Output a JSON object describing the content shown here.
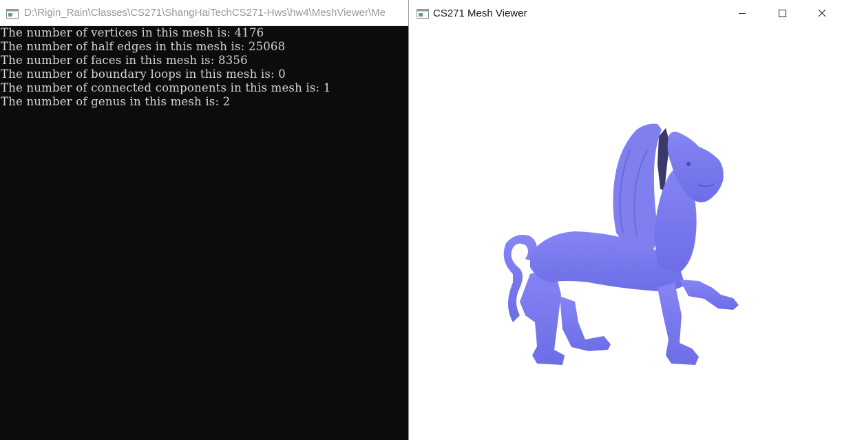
{
  "console_window": {
    "title": "D:\\Rigin_Rain\\Classes\\CS271\\ShangHaiTechCS271-Hws\\hw4\\MeshViewer\\Me",
    "icon": "console-app-icon",
    "lines": [
      "The number of vertices in this mesh is: 4176",
      "The number of half edges in this mesh is: 25068",
      "The number of faces in this mesh is: 8356",
      "The number of boundary loops in this mesh is: 0",
      "The number of connected components in this mesh is: 1",
      "The number of genus in this mesh is: 2"
    ]
  },
  "viewer_window": {
    "title": "CS271 Mesh Viewer",
    "icon": "window-app-icon",
    "controls": {
      "minimize_icon": "minimize-icon",
      "maximize_icon": "maximize-icon",
      "close_icon": "close-icon"
    },
    "model_icon": "winged-lion-mesh",
    "colors": {
      "mesh_fill": "#7f7ff0",
      "mesh_shade": "#5a5ad0",
      "mesh_dark": "#3a3a6a",
      "background": "#ffffff"
    }
  },
  "colors": {
    "console_bg": "#0c0c0c",
    "console_text": "#d4d4d4",
    "titlebar_bg": "#ffffff"
  }
}
